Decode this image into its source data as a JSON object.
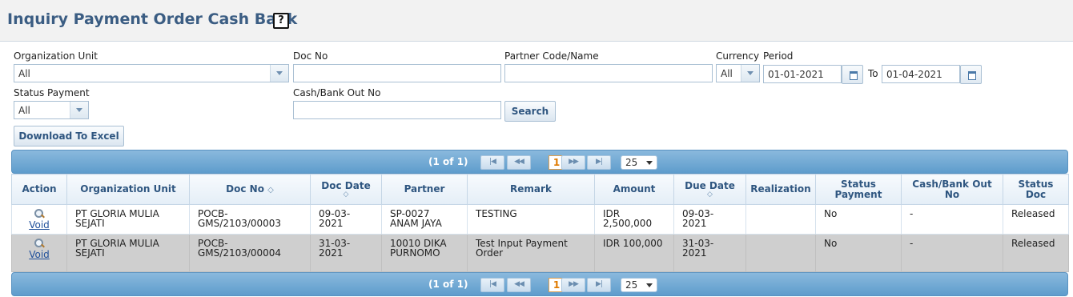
{
  "page": {
    "title": "Inquiry Payment Order Cash Bank",
    "help_label": "?"
  },
  "filters": {
    "org_unit_label": "Organization Unit",
    "org_unit_value": "All",
    "doc_no_label": "Doc No",
    "doc_no_value": "",
    "partner_label": "Partner Code/Name",
    "partner_value": "",
    "currency_label": "Currency",
    "currency_value": "All",
    "period_label": "Period",
    "period_from": "01-01-2021",
    "to_label": "To",
    "period_to": "01-04-2021",
    "status_payment_label": "Status Payment",
    "status_payment_value": "All",
    "cashbank_label": "Cash/Bank Out No",
    "cashbank_value": "",
    "search_label": "Search",
    "download_label": "Download To Excel"
  },
  "pager": {
    "info": "(1 of 1)",
    "current_page": "1",
    "page_size": "25",
    "first_glyph": "|◀",
    "prev_glyph": "◀◀",
    "next_glyph": "▶▶",
    "last_glyph": "▶|"
  },
  "table": {
    "columns": {
      "action": "Action",
      "org_unit": "Organization Unit",
      "doc_no": "Doc No",
      "doc_date": "Doc Date",
      "partner": "Partner",
      "remark": "Remark",
      "amount": "Amount",
      "due_date": "Due Date",
      "realization": "Realization",
      "status_payment": "Status Payment",
      "cashbank_no": "Cash/Bank Out No",
      "status_doc": "Status Doc"
    },
    "rows": [
      {
        "action": "Void",
        "org_unit": "PT GLORIA MULIA SEJATI",
        "doc_no": "POCB-GMS/2103/00003",
        "doc_date": "09-03-2021",
        "partner": "SP-0027 ANAM JAYA",
        "remark": "TESTING",
        "amount": "IDR 2,500,000",
        "due_date": "09-03-2021",
        "realization": "",
        "status_payment": "No",
        "cashbank_no": "-",
        "status_doc": "Released"
      },
      {
        "action": "Void",
        "org_unit": "PT GLORIA MULIA SEJATI",
        "doc_no": "POCB-GMS/2103/00004",
        "doc_date": "31-03-2021",
        "partner": "10010 DIKA PURNOMO",
        "remark": "Test Input Payment Order",
        "amount": "IDR 100,000",
        "due_date": "31-03-2021",
        "realization": "",
        "status_payment": "No",
        "cashbank_no": "-",
        "status_doc": "Released"
      }
    ]
  }
}
